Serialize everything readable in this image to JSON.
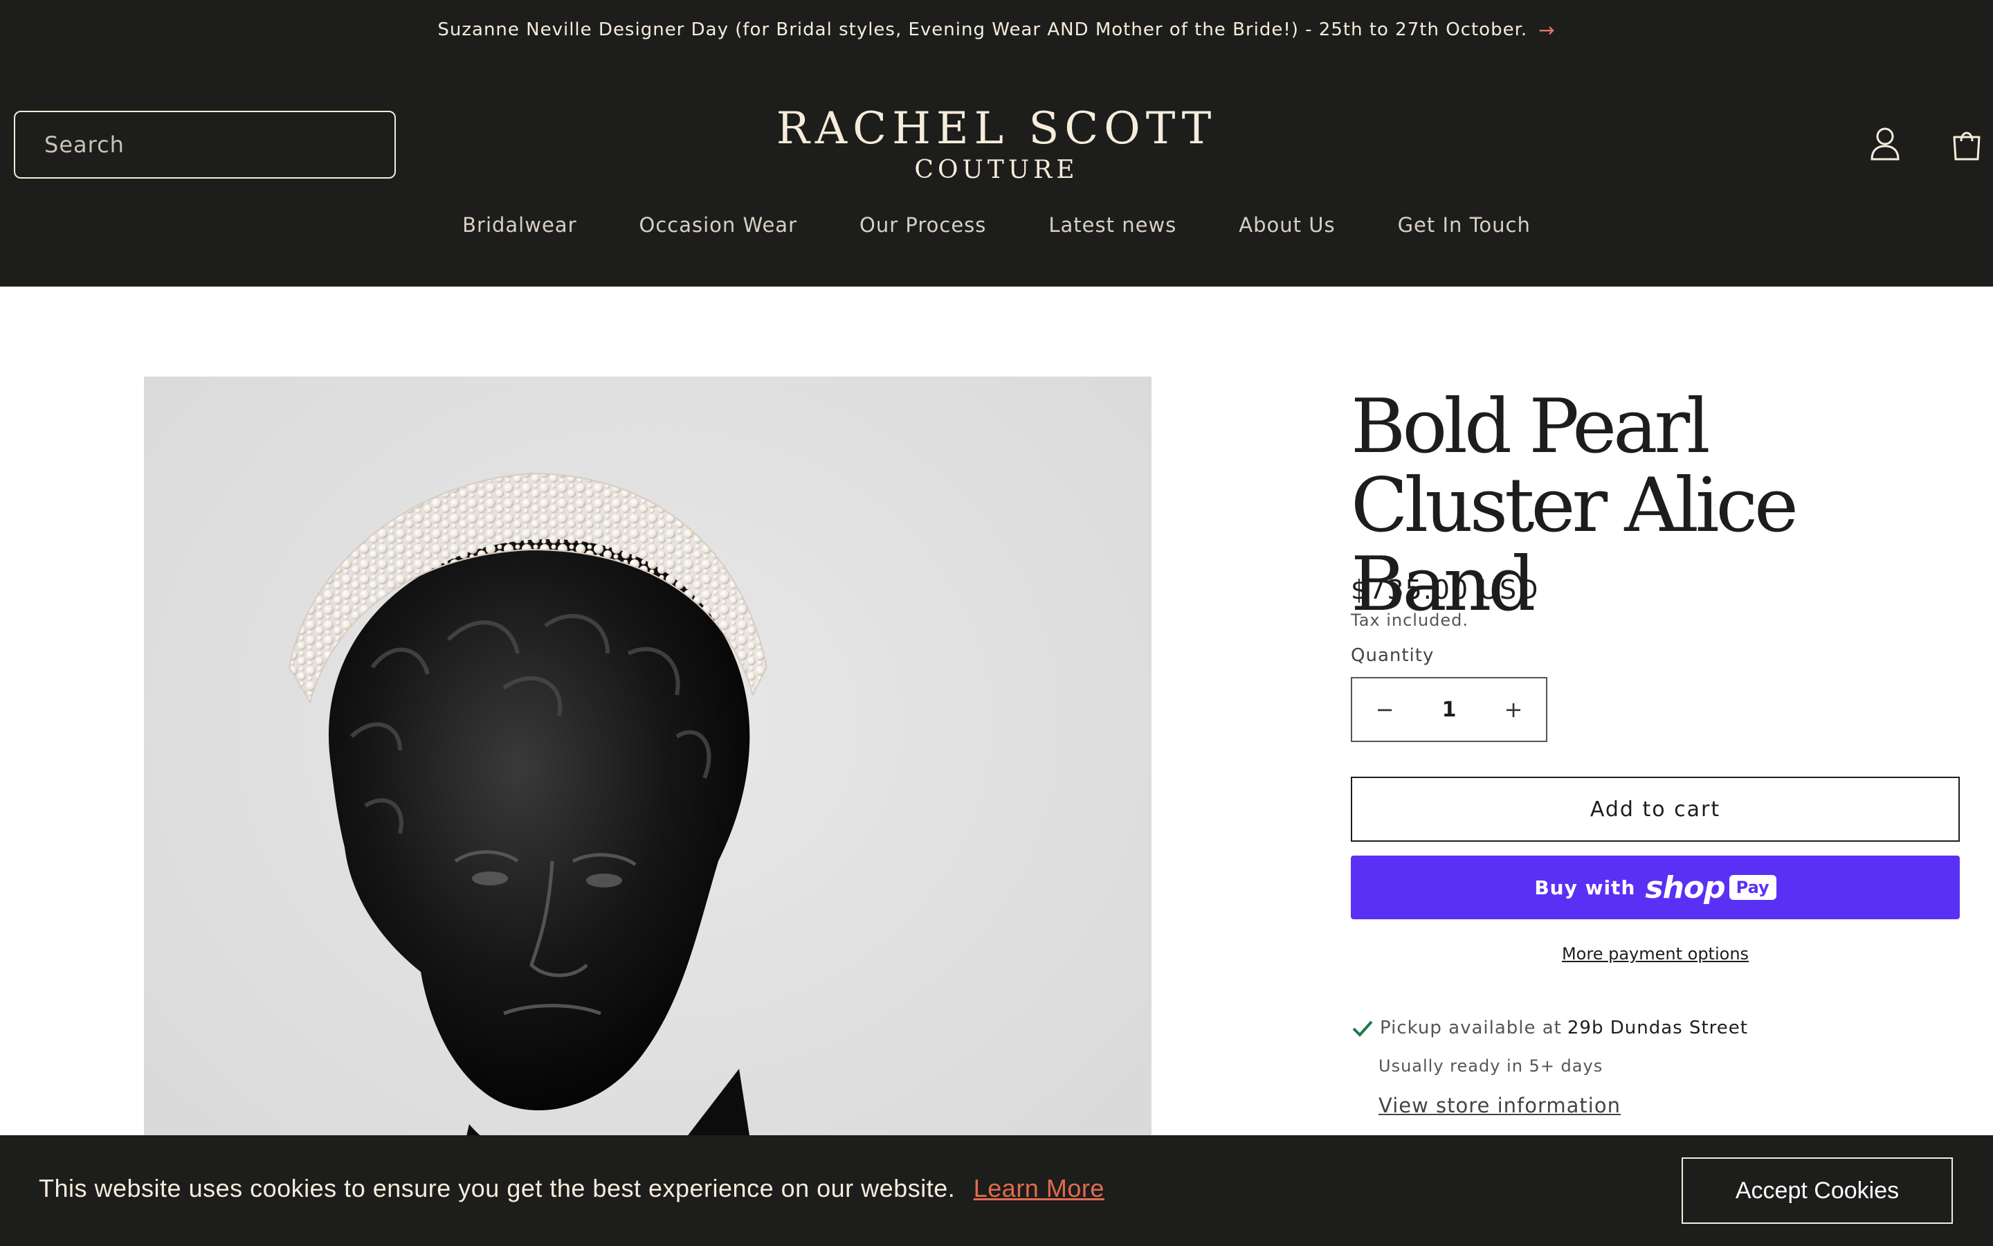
{
  "announcement": {
    "text": "Suzanne Neville Designer Day (for Bridal styles, Evening Wear AND Mother of the Bride!) - 25th to 27th October.",
    "arrow_icon": "arrow-right-icon"
  },
  "header": {
    "search_placeholder": "Search",
    "logo_line1": "RACHEL SCOTT",
    "logo_line2": "COUTURE",
    "account_icon": "account-icon",
    "cart_icon": "cart-icon"
  },
  "nav": {
    "items": [
      {
        "label": "Bridalwear"
      },
      {
        "label": "Occasion Wear"
      },
      {
        "label": "Our Process"
      },
      {
        "label": "Latest news"
      },
      {
        "label": "About Us"
      },
      {
        "label": "Get In Touch"
      }
    ]
  },
  "product": {
    "title": "Bold Pearl Cluster Alice Band",
    "price": "$735.00 USD",
    "tax_note": "Tax included.",
    "quantity_label": "Quantity",
    "quantity_value": "1",
    "minus": "−",
    "plus": "+",
    "add_to_cart": "Add to cart",
    "buy_with": "Buy with",
    "shop": "shop",
    "pay": "Pay",
    "more_payment_options": "More payment options",
    "pickup_prefix": "Pickup available at",
    "pickup_location": "29b Dundas Street",
    "ready_note": "Usually ready in 5+ days",
    "view_store": "View store information"
  },
  "cookie": {
    "message": "This website uses cookies to ensure you get the best experience on our website.",
    "learn_more": "Learn More",
    "accept": "Accept Cookies"
  },
  "colors": {
    "header_bg": "#1d1d1b",
    "cream": "#f5ecdc",
    "shop_pay": "#5a31f4",
    "learn_more": "#e06c4f",
    "check": "#1e7a4a"
  }
}
